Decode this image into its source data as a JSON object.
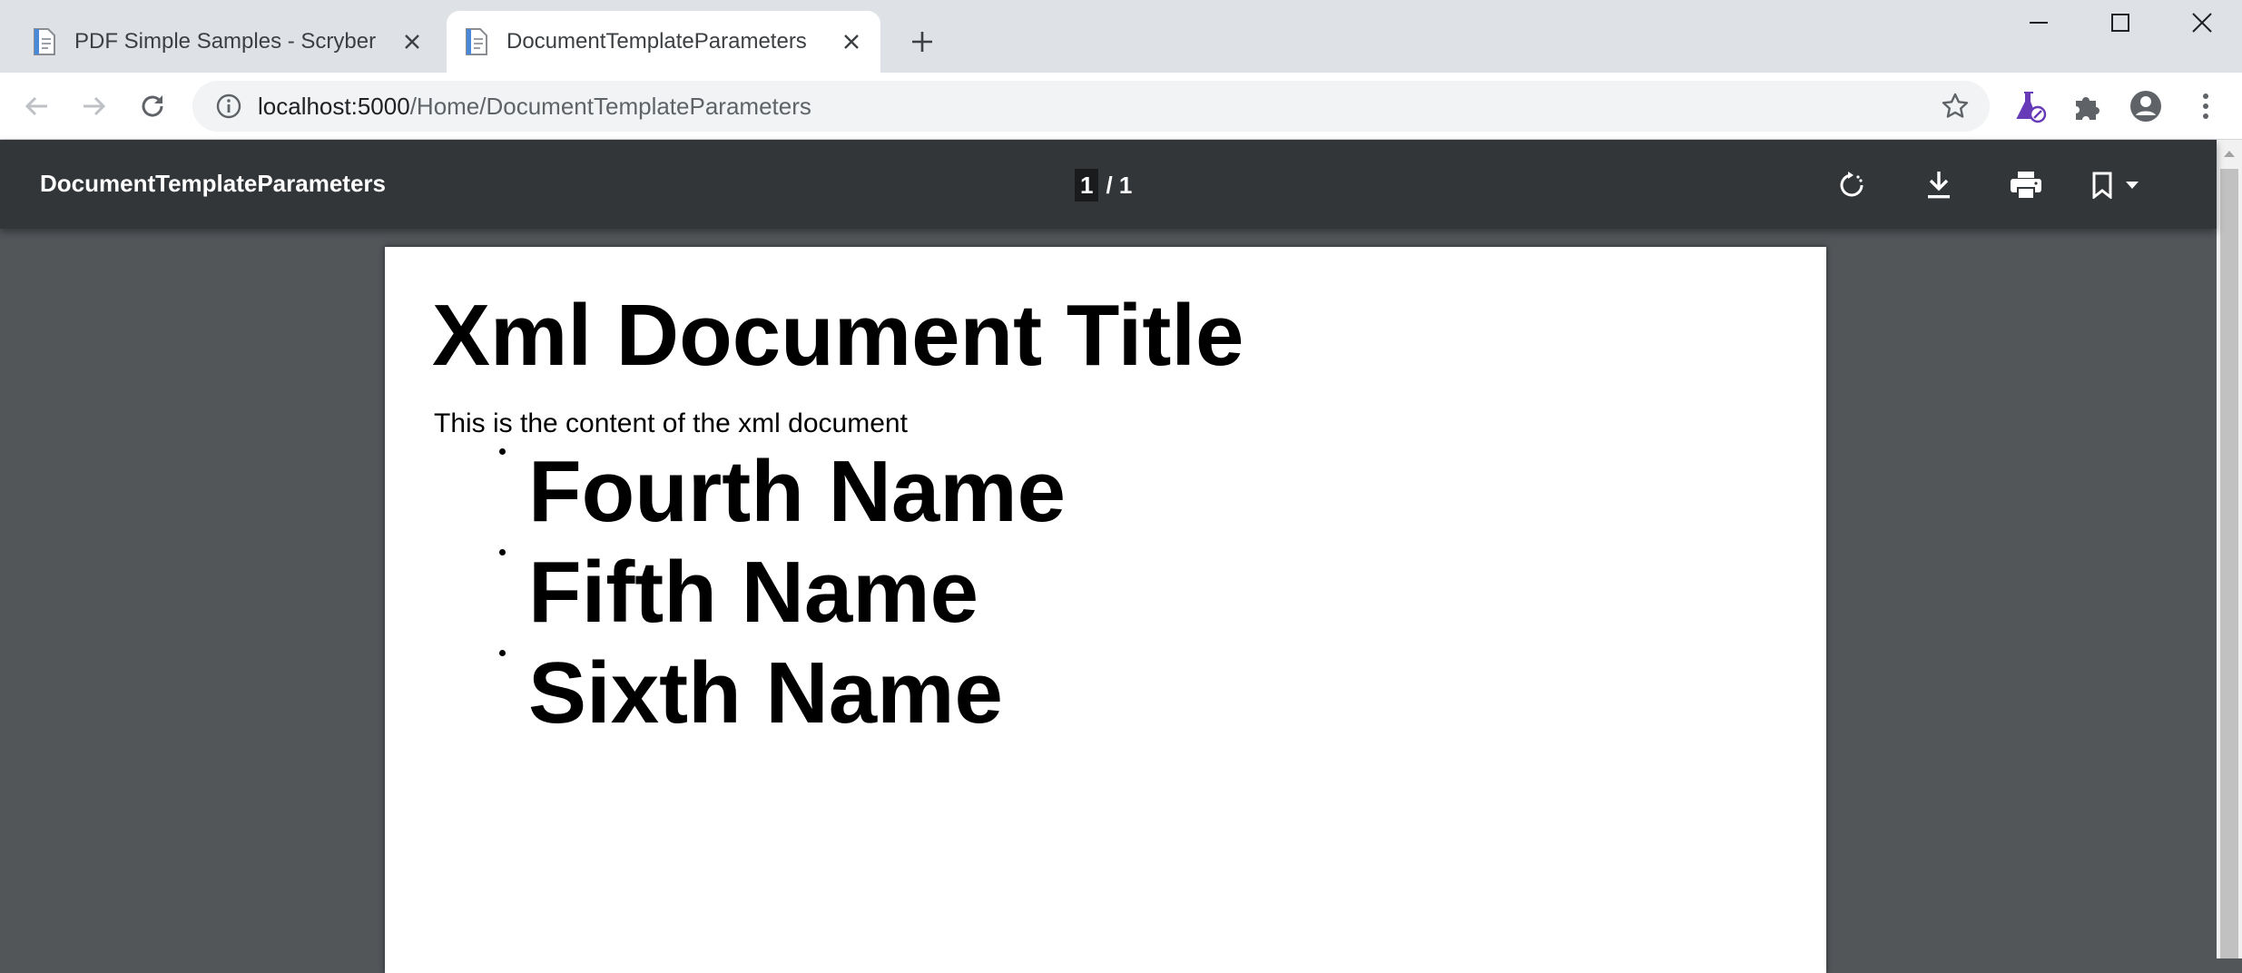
{
  "browser": {
    "tabs": [
      {
        "title": "PDF Simple Samples - Scryber",
        "active": false
      },
      {
        "title": "DocumentTemplateParameters",
        "active": true
      }
    ],
    "address": {
      "host": "localhost:5000",
      "path": "/Home/DocumentTemplateParameters"
    }
  },
  "viewer": {
    "title": "DocumentTemplateParameters",
    "current_page": "1",
    "page_total": "/ 1"
  },
  "document": {
    "title": "Xml Document Title",
    "body": "This is the content of the xml document",
    "items": [
      "Fourth Name",
      "Fifth Name",
      "Sixth Name"
    ]
  },
  "colors": {
    "tab_strip": "#dee1e6",
    "viewer_bar": "#323639",
    "viewer_background": "#525659",
    "extension_accent": "#673ab7"
  }
}
